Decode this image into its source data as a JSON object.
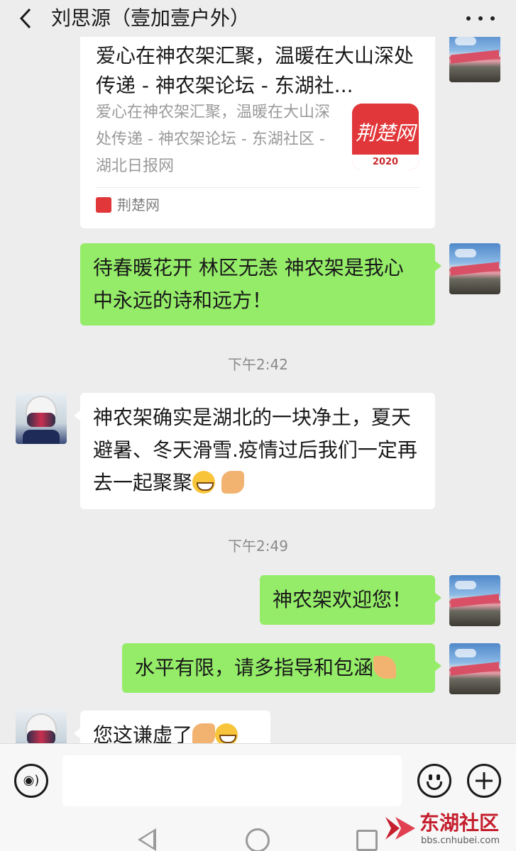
{
  "header": {
    "title": "刘思源（壹加壹户外）"
  },
  "link_card": {
    "title": "爱心在神农架汇聚，温暖在大山深处传递 - 神农架论坛 - 东湖社...",
    "description": "爱心在神农架汇聚，温暖在大山深处传递 - 神农架论坛 - 东湖社区 - 湖北日报网",
    "thumb_text": "荆楚网",
    "thumb_year": "2020",
    "source_name": "荆楚网"
  },
  "messages": [
    {
      "id": "m1",
      "side": "right",
      "text": "待春暖花开 林区无恙 神农架是我心中永远的诗和远方！"
    },
    {
      "id": "t1",
      "type": "time",
      "text": "下午2:42"
    },
    {
      "id": "m2",
      "side": "left",
      "text": "神农架确实是湖北的一块净土，夏天避暑、冬天滑雪.疫情过后我们一定再去一起聚聚"
    },
    {
      "id": "t2",
      "type": "time",
      "text": "下午2:49"
    },
    {
      "id": "m3",
      "side": "right",
      "text": "神农架欢迎您！"
    },
    {
      "id": "m4",
      "side": "right",
      "text": "水平有限，请多指导和包涵"
    },
    {
      "id": "m5",
      "side": "left",
      "text": "您这谦虚了"
    }
  ],
  "icons": {
    "back": "chevron-left-icon",
    "more": "more-dots-icon",
    "voice": "voice-icon",
    "emoji": "emoji-icon",
    "plus": "plus-icon"
  },
  "watermark": {
    "name": "东湖社区",
    "url": "bbs.cnhubei.com"
  },
  "colors": {
    "green_bubble": "#95ec69",
    "background": "#ededed",
    "brand_red": "#c51f2e"
  }
}
